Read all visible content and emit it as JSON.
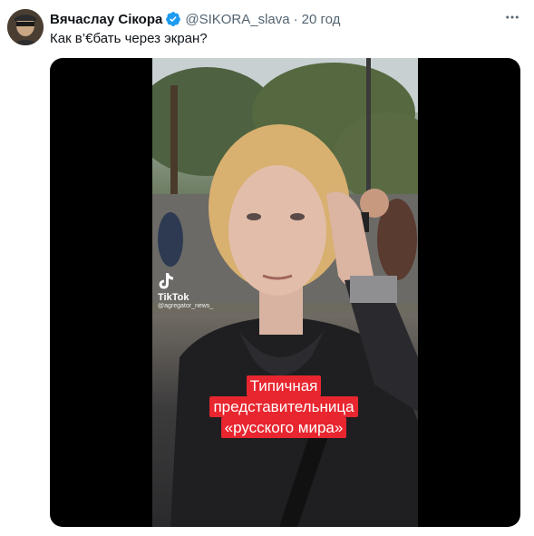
{
  "tweet": {
    "author_name": "Вячаслау Сікора",
    "handle": "@SIKORA_slava",
    "dot": "·",
    "time": "20 год",
    "text": "Как в’€бать через экран?",
    "verified": true
  },
  "video": {
    "watermark_app": "TikTok",
    "watermark_user": "@agregator_news_",
    "caption_lines": [
      "Типичная",
      "представительница",
      "«русского мира»"
    ]
  },
  "colors": {
    "verified": "#1d9bf0",
    "caption_bg": "#e8262f",
    "secondary_text": "#536471"
  },
  "icons": {
    "verified": "verified-badge-icon",
    "more": "more-options-icon",
    "tiktok": "tiktok-logo-icon"
  }
}
